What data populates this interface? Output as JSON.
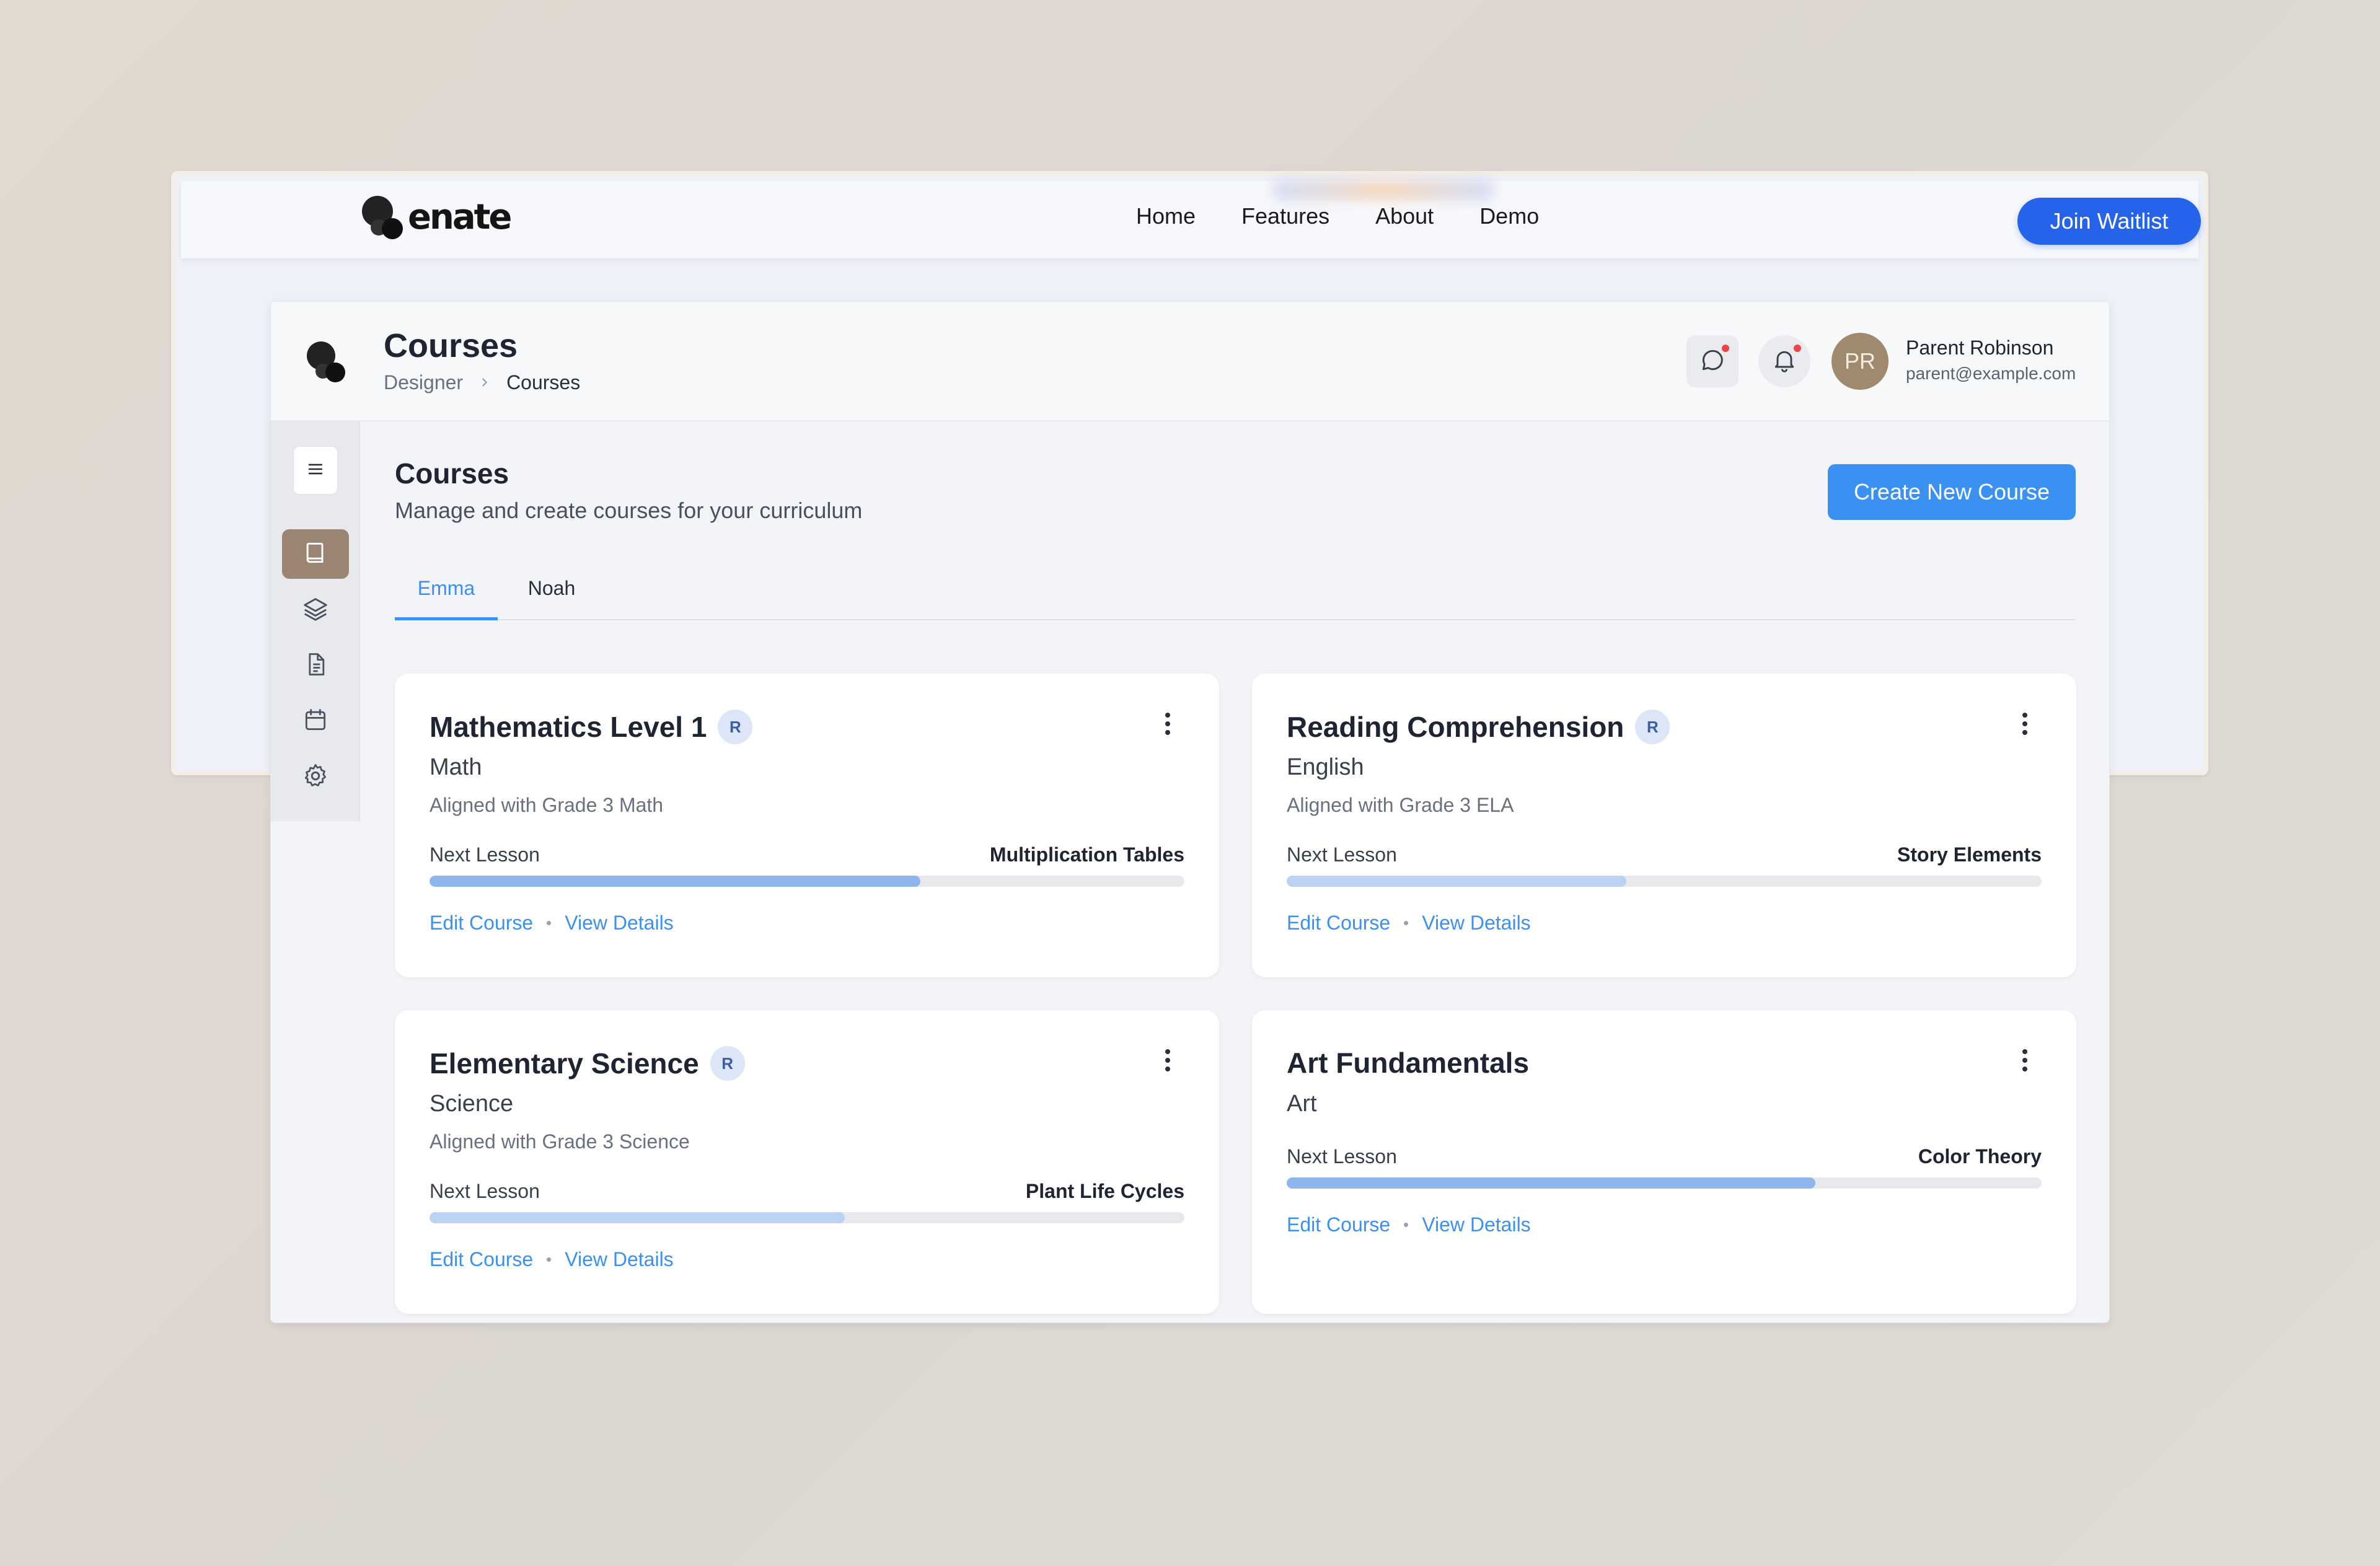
{
  "site": {
    "brand": "enate",
    "nav": [
      "Home",
      "Features",
      "About",
      "Demo"
    ],
    "cta": "Join Waitlist"
  },
  "app": {
    "title": "Courses",
    "breadcrumb": [
      "Designer",
      "Courses"
    ],
    "user": {
      "initials": "PR",
      "name": "Parent Robinson",
      "email": "parent@example.com"
    },
    "accent": "#3b91f2",
    "sidebar_active_color": "#9a8472",
    "sidebar_icons": [
      "menu-icon",
      "book-icon",
      "layers-icon",
      "document-icon",
      "calendar-icon",
      "gear-icon"
    ]
  },
  "main": {
    "title": "Courses",
    "subtitle": "Manage and create courses for your curriculum",
    "create_label": "Create New Course",
    "tabs": [
      {
        "label": "Emma",
        "active": true
      },
      {
        "label": "Noah",
        "active": false
      }
    ]
  },
  "courses": [
    {
      "title": "Mathematics Level 1",
      "badge": "R",
      "subject": "Math",
      "aligned": "Aligned with Grade 3 Math",
      "next_label": "Next Lesson",
      "next_lesson": "Multiplication Tables",
      "progress": 0.65,
      "bar_color": "#8fb6ec",
      "edit": "Edit Course",
      "view": "View Details"
    },
    {
      "title": "Reading Comprehension",
      "badge": "R",
      "subject": "English",
      "aligned": "Aligned with Grade 3 ELA",
      "next_label": "Next Lesson",
      "next_lesson": "Story Elements",
      "progress": 0.45,
      "bar_color": "#bcd2f2",
      "edit": "Edit Course",
      "view": "View Details"
    },
    {
      "title": "Elementary Science",
      "badge": "R",
      "subject": "Science",
      "aligned": "Aligned with Grade 3 Science",
      "next_label": "Next Lesson",
      "next_lesson": "Plant Life Cycles",
      "progress": 0.55,
      "bar_color": "#bcd2f2",
      "edit": "Edit Course",
      "view": "View Details"
    },
    {
      "title": "Art Fundamentals",
      "badge": "",
      "subject": "Art",
      "aligned": "",
      "next_label": "Next Lesson",
      "next_lesson": "Color Theory",
      "progress": 0.7,
      "bar_color": "#8fb6ec",
      "edit": "Edit Course",
      "view": "View Details"
    }
  ]
}
